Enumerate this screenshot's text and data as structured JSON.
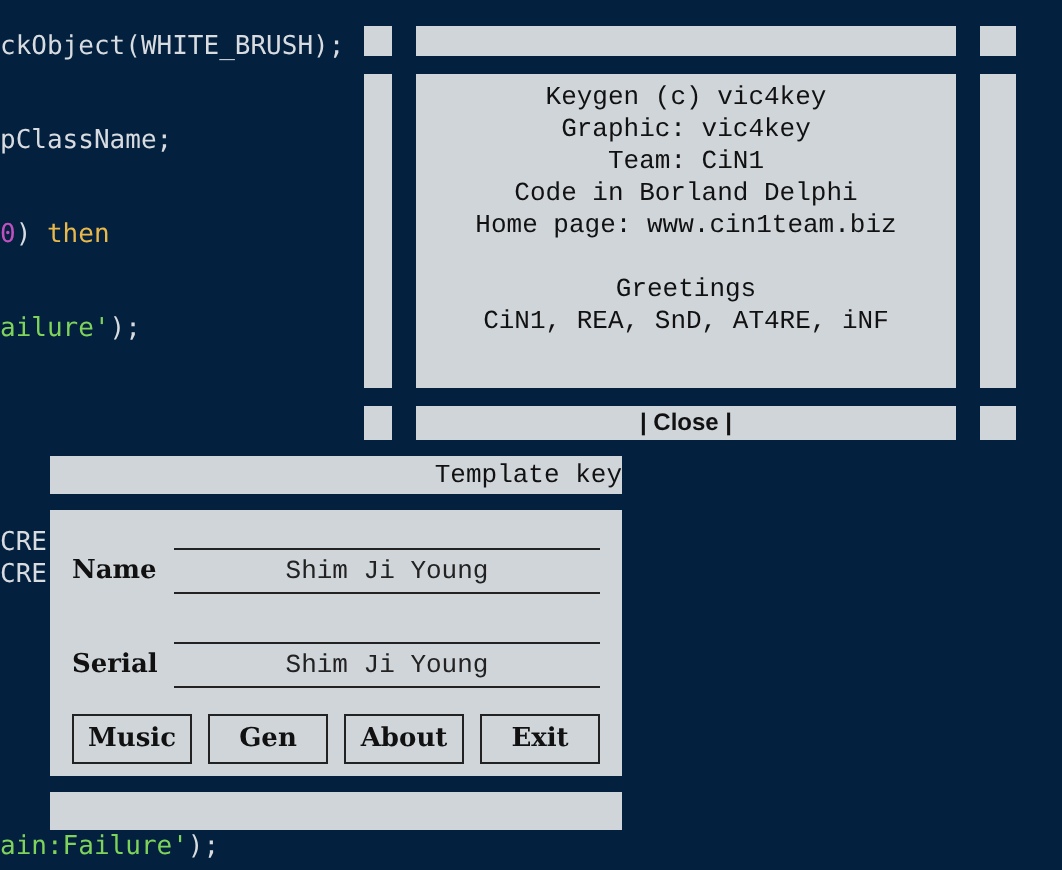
{
  "code_lines": [
    {
      "segments": [
        {
          "text": "ckObject(WHITE_BRUSH);",
          "kind": "plain"
        }
      ]
    },
    {
      "segments": [
        {
          "text": "pClassName;",
          "kind": "plain"
        }
      ]
    },
    {
      "segments": [
        {
          "text": "0",
          "kind": "number"
        },
        {
          "text": ") ",
          "kind": "plain"
        },
        {
          "text": "then",
          "kind": "keyword"
        }
      ]
    },
    {
      "segments": [
        {
          "text": "ailure'",
          "kind": "string"
        },
        {
          "text": ");",
          "kind": "plain"
        }
      ]
    }
  ],
  "code_lines_lower": [
    {
      "segments": [
        {
          "text": "CRE",
          "kind": "plain"
        }
      ]
    },
    {
      "segments": [
        {
          "text": "CRE",
          "kind": "plain"
        }
      ]
    }
  ],
  "code_lines_bottom": [
    {
      "segments": [
        {
          "text": "ain:Failure'",
          "kind": "string"
        },
        {
          "text": ");",
          "kind": "plain"
        }
      ]
    }
  ],
  "about": {
    "lines": [
      "Keygen (c) vic4key",
      "Graphic: vic4key",
      "Team: CiN1",
      "Code in Borland Delphi",
      "Home page: www.cin1team.biz"
    ],
    "greetings": [
      "Greetings",
      "CiN1, REA, SnD, AT4RE, iNF"
    ],
    "close_button": "| Close |"
  },
  "keygen": {
    "title": "Template key",
    "fields": [
      {
        "label": "Name",
        "value": "Shim Ji Young"
      },
      {
        "label": "Serial",
        "value": "Shim Ji Young"
      }
    ],
    "buttons": [
      "Music",
      "Gen",
      "About",
      "Exit"
    ]
  }
}
